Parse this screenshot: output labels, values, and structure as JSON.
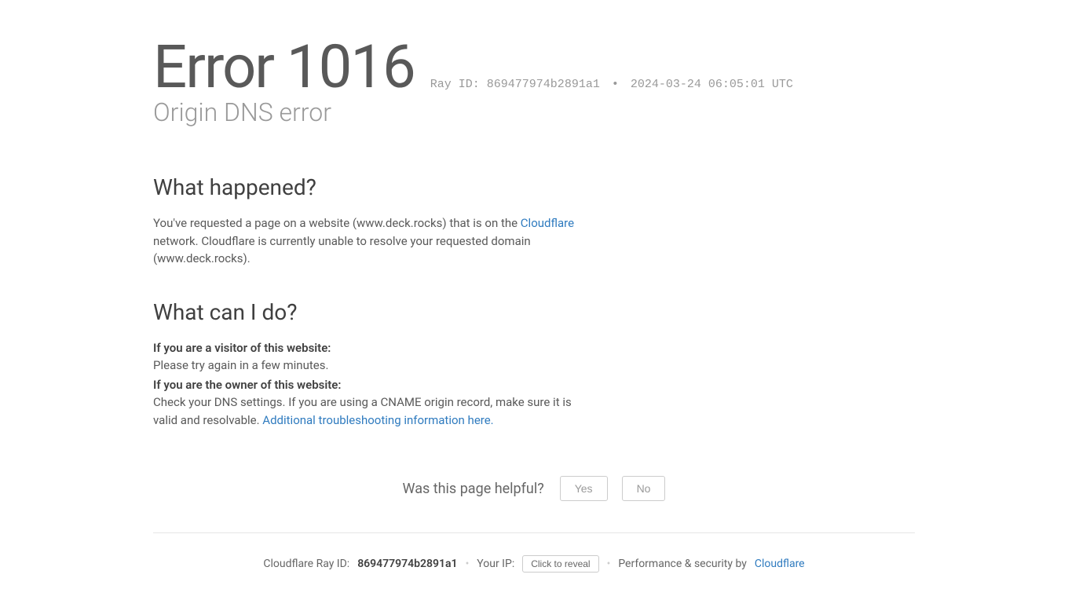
{
  "header": {
    "error_code": "Error 1016",
    "ray_label": "Ray ID:",
    "ray_id": "869477974b2891a1",
    "bullet": "•",
    "timestamp": "2024-03-24 06:05:01 UTC",
    "subtitle": "Origin DNS error"
  },
  "what_happened": {
    "heading": "What happened?",
    "text_before_link": "You've requested a page on a website (www.deck.rocks) that is on the ",
    "link_text": "Cloudflare",
    "text_after_link": " network. Cloudflare is currently unable to resolve your requested domain (www.deck.rocks)."
  },
  "what_do": {
    "heading": "What can I do?",
    "visitor_bold": "If you are a visitor of this website:",
    "visitor_text": "Please try again in a few minutes.",
    "owner_bold": "If you are the owner of this website:",
    "owner_text_before_link": "Check your DNS settings. If you are using a CNAME origin record, make sure it is valid and resolvable. ",
    "owner_link_text": "Additional troubleshooting information here."
  },
  "helpful": {
    "question": "Was this page helpful?",
    "yes": "Yes",
    "no": "No"
  },
  "footer": {
    "cf_ray_label": "Cloudflare Ray ID:",
    "cf_ray_id": "869477974b2891a1",
    "your_ip_label": "Your IP:",
    "reveal": "Click to reveal",
    "perf_label": "Performance & security by",
    "cf_link": "Cloudflare",
    "sep": "•"
  }
}
